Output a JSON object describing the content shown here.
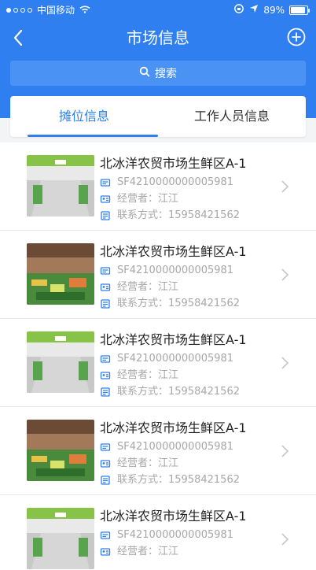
{
  "status": {
    "carrier": "中国移动",
    "battery": "89%"
  },
  "nav": {
    "title": "市场信息"
  },
  "search": {
    "label": "搜索"
  },
  "tabs": [
    {
      "label": "摊位信息",
      "active": true
    },
    {
      "label": "工作人员信息",
      "active": false
    }
  ],
  "stalls": [
    {
      "name": "北冰洋农贸市场生鲜区A-1",
      "code": "SF4210000000005981",
      "operator": "经营者：江江",
      "contact": "联系方式：15958421562"
    },
    {
      "name": "北冰洋农贸市场生鲜区A-1",
      "code": "SF4210000000005981",
      "operator": "经营者：江江",
      "contact": "联系方式：15958421562"
    },
    {
      "name": "北冰洋农贸市场生鲜区A-1",
      "code": "SF4210000000005981",
      "operator": "经营者：江江",
      "contact": "联系方式：15958421562"
    },
    {
      "name": "北冰洋农贸市场生鲜区A-1",
      "code": "SF4210000000005981",
      "operator": "经营者：江江",
      "contact": "联系方式：15958421562"
    },
    {
      "name": "北冰洋农贸市场生鲜区A-1",
      "code": "SF4210000000005981",
      "operator": "经营者：江江",
      "contact": ""
    }
  ],
  "colors": {
    "primary": "#2f7ff0",
    "search_bg": "#4a92f3",
    "meta_text": "#a7a7a7"
  },
  "icons": {
    "back": "chevron-left-icon",
    "add": "plus-circle-icon",
    "search": "search-icon"
  }
}
